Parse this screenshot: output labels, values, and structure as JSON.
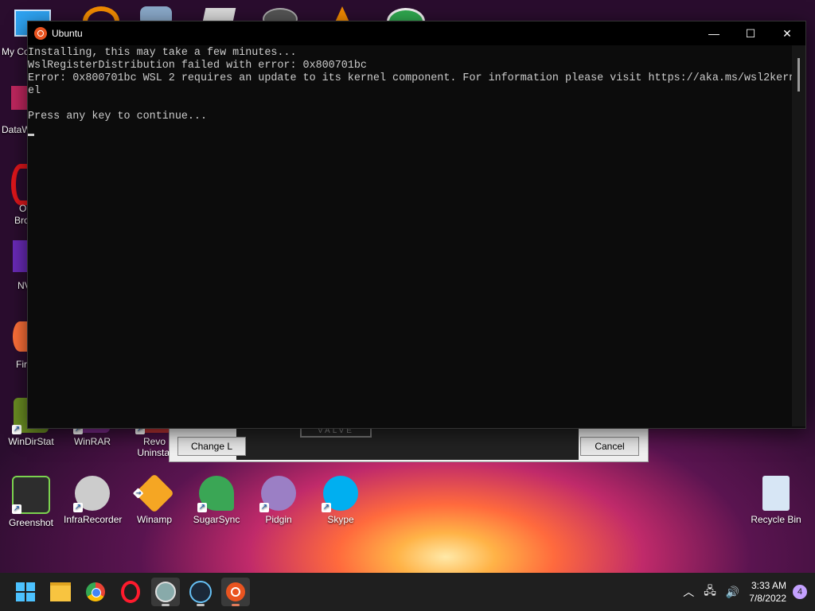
{
  "console": {
    "title": "Ubuntu",
    "lines": [
      "Installing, this may take a few minutes...",
      "WslRegisterDistribution failed with error: 0x800701bc",
      "Error: 0x800701bc WSL 2 requires an update to its kernel component. For information please visit https://aka.ms/wsl2kern",
      "el",
      "",
      "Press any key to continue..."
    ],
    "minimize": "—",
    "maximize": "☐",
    "close": "✕"
  },
  "left_icons": [
    "My Co",
    "DataW",
    "Op",
    "Bro",
    "NV",
    "Fir"
  ],
  "desktop_icons": [
    {
      "label": "WinDirStat"
    },
    {
      "label": "WinRAR"
    },
    {
      "label": "Revo"
    },
    {
      "label": "Uninstal"
    },
    {
      "label": "Greenshot"
    },
    {
      "label": "InfraRecorder"
    },
    {
      "label": "Winamp"
    },
    {
      "label": "SugarSync"
    },
    {
      "label": "Pidgin"
    },
    {
      "label": "Skype"
    },
    {
      "label": "Recycle Bin"
    }
  ],
  "background_dialog": {
    "left_button": "Change L",
    "right_button": "Cancel",
    "valve": "VALVE"
  },
  "taskbar": {
    "time": "3:33 AM",
    "date": "7/8/2022",
    "notifications": "4"
  },
  "colors": {
    "ubuntu": "#e95420",
    "console_bg": "#0c0c0c",
    "taskbar_bg": "#1f1f1f"
  }
}
